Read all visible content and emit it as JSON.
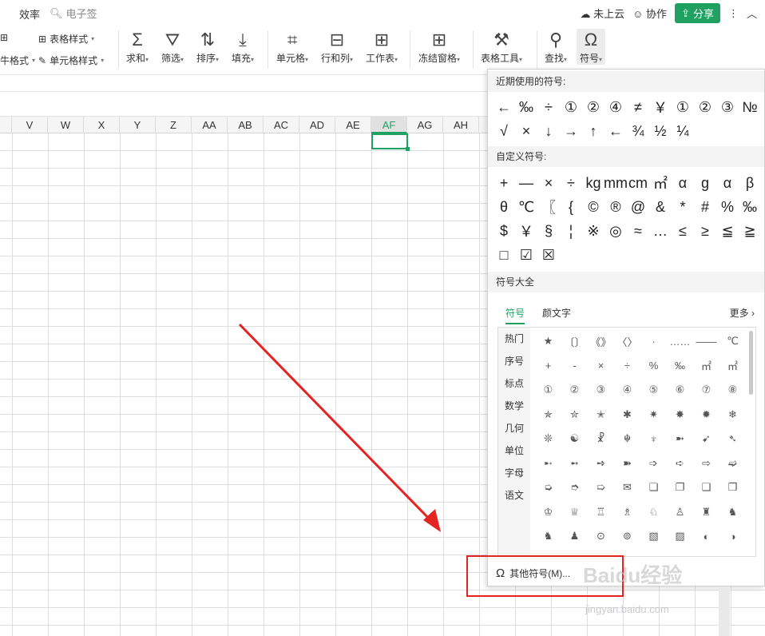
{
  "topbar": {
    "tab": "效率",
    "search": "电子签",
    "cloud": "未上云",
    "collab": "协作",
    "share": "分享"
  },
  "ribbon": {
    "table_style": "表格样式",
    "cell_style": "单元格样式",
    "format": "牛格式",
    "sum": "求和",
    "filter": "筛选",
    "sort": "排序",
    "fill": "填充",
    "cell": "单元格",
    "rowcol": "行和列",
    "sheet": "工作表",
    "freeze": "冻结窗格",
    "tools": "表格工具",
    "find": "查找",
    "symbol": "符号"
  },
  "columns": [
    "V",
    "W",
    "X",
    "Y",
    "Z",
    "AA",
    "AB",
    "AC",
    "AD",
    "AE",
    "AF",
    "AG",
    "AH"
  ],
  "selected_column": "AF",
  "panel": {
    "recent_title": "近期使用的符号:",
    "recent": [
      [
        "←",
        "‰",
        "÷",
        "①",
        "②",
        "④",
        "≠",
        "￥",
        "①",
        "②",
        "③",
        "№"
      ],
      [
        "√",
        "×",
        "↓",
        "→",
        "↑",
        "←",
        "¾",
        "½",
        "¼"
      ]
    ],
    "custom_title": "自定义符号:",
    "custom": [
      [
        "+",
        "—",
        "×",
        "÷",
        "kg",
        "mm",
        "cm",
        "㎡",
        "α",
        "g",
        "α",
        "β"
      ],
      [
        "θ",
        "℃",
        "〖",
        "{",
        "©",
        "®",
        "@",
        "&",
        "*",
        "#",
        "%",
        "‰"
      ],
      [
        "$",
        "￥",
        "§",
        "¦",
        "※",
        "◎",
        "≈",
        "…",
        "≤",
        "≥",
        "≦",
        "≧"
      ],
      [
        "□",
        "☑",
        "☒"
      ]
    ],
    "library_title": "符号大全",
    "tab_symbols": "符号",
    "tab_kaomoji": "颜文字",
    "more": "更多",
    "categories": [
      "热门",
      "序号",
      "标点",
      "数学",
      "几何",
      "单位",
      "字母",
      "语文"
    ],
    "grid": [
      [
        "★",
        "〔〕",
        "《》",
        "〈〉",
        "·",
        "……",
        "——",
        "℃"
      ],
      [
        "+",
        "-",
        "×",
        "÷",
        "%",
        "‰",
        "㎡",
        "㎡"
      ],
      [
        "①",
        "②",
        "③",
        "④",
        "⑤",
        "⑥",
        "⑦",
        "⑧"
      ],
      [
        "✯",
        "✮",
        "✭",
        "✱",
        "✷",
        "✸",
        "✹",
        "❄"
      ],
      [
        "❊",
        "☯",
        "☧",
        "☬",
        "♆",
        "➼",
        "➹",
        "➴"
      ],
      [
        "➸",
        "➻",
        "➺",
        "➽",
        "➩",
        "➪",
        "⇨",
        "➫"
      ],
      [
        "➭",
        "➮",
        "➯",
        "✉",
        "❏",
        "❐",
        "❑",
        "❒"
      ],
      [
        "♔",
        "♕",
        "♖",
        "♗",
        "♘",
        "♙",
        "♜",
        "♞"
      ],
      [
        "♞",
        "♟",
        "⊙",
        "⊚",
        "▧",
        "▨",
        "◐",
        "◑"
      ]
    ],
    "other_symbols": "其他符号(M)..."
  },
  "watermark": "Baidu经验",
  "watermark_url": "jingyan.baidu.com",
  "colors": {
    "accent": "#20a162",
    "annotation": "#e52323"
  }
}
